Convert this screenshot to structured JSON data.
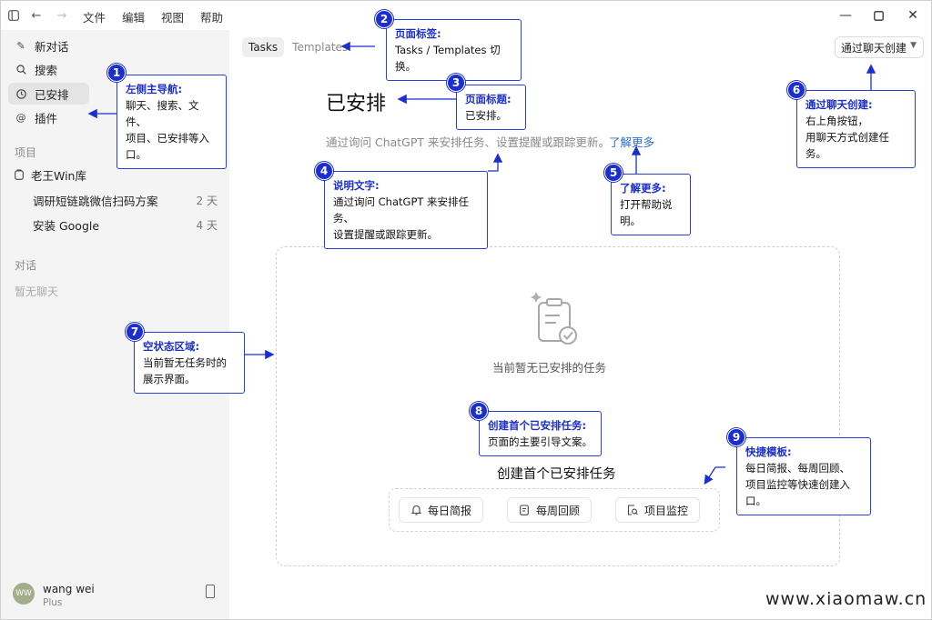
{
  "menu": [
    "文件",
    "编辑",
    "视图",
    "帮助"
  ],
  "sidebar": {
    "nav": [
      {
        "label": "新对话",
        "icon": "edit-icon"
      },
      {
        "label": "搜索",
        "icon": "search-icon"
      },
      {
        "label": "已安排",
        "icon": "clock-icon"
      },
      {
        "label": "插件",
        "icon": "at-icon"
      }
    ],
    "projects_label": "项目",
    "project_name": "老王Win库",
    "project_items": [
      {
        "title": "调研短链跳微信扫码方案",
        "days": "2 天"
      },
      {
        "title": "安装 Google",
        "days": "4 天"
      }
    ],
    "chats_label": "对话",
    "empty_chats": "暂无聊天",
    "user": {
      "initials": "WW",
      "name": "wang wei",
      "plan": "Plus"
    }
  },
  "main": {
    "tabs": [
      "Tasks",
      "Templates"
    ],
    "create_button": "通过聊天创建",
    "title": "已安排",
    "description": "通过询问 ChatGPT 来安排任务、设置提醒或跟踪更新。",
    "learn_more": "了解更多",
    "empty_text": "当前暂无已安排的任务",
    "cta_title": "创建首个已安排任务",
    "templates": [
      {
        "label": "每日简报",
        "icon": "bell-icon"
      },
      {
        "label": "每周回顾",
        "icon": "calendar-icon"
      },
      {
        "label": "项目监控",
        "icon": "doc-search-icon"
      }
    ]
  },
  "annotations": [
    {
      "num": "1",
      "title": "左侧主导航:",
      "lines": [
        "聊天、搜索、文件、",
        "项目、已安排等入口。"
      ]
    },
    {
      "num": "2",
      "title": "页面标签:",
      "lines": [
        "Tasks / Templates 切换。"
      ]
    },
    {
      "num": "3",
      "title": "页面标题:",
      "lines": [
        "已安排。"
      ]
    },
    {
      "num": "4",
      "title": "说明文字:",
      "lines": [
        "通过询问 ChatGPT 来安排任务、",
        "设置提醒或跟踪更新。"
      ]
    },
    {
      "num": "5",
      "title": "了解更多:",
      "lines": [
        "打开帮助说明。"
      ]
    },
    {
      "num": "6",
      "title": "通过聊天创建:",
      "lines": [
        "右上角按钮，",
        "用聊天方式创建任务。"
      ]
    },
    {
      "num": "7",
      "title": "空状态区域:",
      "lines": [
        "当前暂无任务时的",
        "展示界面。"
      ]
    },
    {
      "num": "8",
      "title": "创建首个已安排任务:",
      "lines": [
        "页面的主要引导文案。"
      ]
    },
    {
      "num": "9",
      "title": "快捷模板:",
      "lines": [
        "每日简报、每周回顾、",
        "项目监控等快速创建入口。"
      ]
    }
  ],
  "watermark": "www.xiaomaw.cn",
  "colors": {
    "accent": "#1b2fcf",
    "link": "#2d6fd0",
    "sidebar_bg": "#f4f4f4"
  }
}
